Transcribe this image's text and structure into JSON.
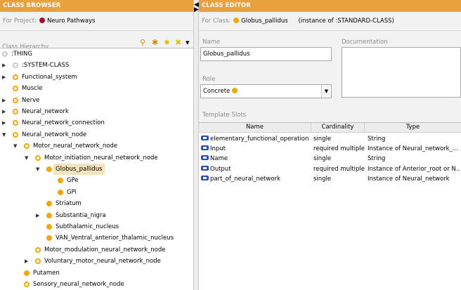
{
  "left_panel": {
    "title": "CLASS BROWSER",
    "for_project_label": "For Project:",
    "project_name": "Neuro Pathways",
    "hierarchy_label": "Class Hierarchy",
    "tools": [
      "search-icon",
      "add-subclass-icon",
      "add-class-icon",
      "delete-icon",
      "dropdown-icon"
    ],
    "tool_glyphs": [
      "⚲",
      "✱",
      "✸",
      "✖",
      "▾"
    ],
    "tree": [
      {
        "label": ":THING",
        "indent": 0,
        "toggle": "",
        "dot": "gray"
      },
      {
        "label": ":SYSTEM-CLASS",
        "indent": 0,
        "toggle": "▶",
        "dot": "gray"
      },
      {
        "label": "Functional_system",
        "indent": 0,
        "toggle": "▶",
        "dot": "hollow"
      },
      {
        "label": "Muscle",
        "indent": 0,
        "toggle": "",
        "dot": "hollow"
      },
      {
        "label": "Nerve",
        "indent": 0,
        "toggle": "▶",
        "dot": "hollow"
      },
      {
        "label": "Neural_network",
        "indent": 0,
        "toggle": "▶",
        "dot": "hollow"
      },
      {
        "label": "Neural_network_connection",
        "indent": 0,
        "toggle": "▶",
        "dot": "hollow"
      },
      {
        "label": "Neural_network_node",
        "indent": 0,
        "toggle": "▼",
        "dot": "hollow"
      },
      {
        "label": "Motor_neural_network_node",
        "indent": 1,
        "toggle": "▼",
        "dot": "hollow"
      },
      {
        "label": "Motor_initiation_neural_network_node",
        "indent": 2,
        "toggle": "▼",
        "dot": "hollow"
      },
      {
        "label": "Globus_pallidus",
        "indent": 3,
        "toggle": "▼",
        "dot": "solid",
        "selected": true
      },
      {
        "label": "GPe",
        "indent": 4,
        "toggle": "",
        "dot": "solid"
      },
      {
        "label": "GPi",
        "indent": 4,
        "toggle": "",
        "dot": "solid"
      },
      {
        "label": "Striatum",
        "indent": 3,
        "toggle": "",
        "dot": "solid"
      },
      {
        "label": "Substantia_nigra",
        "indent": 3,
        "toggle": "▶",
        "dot": "solid"
      },
      {
        "label": "Subthalamic_nucleus",
        "indent": 3,
        "toggle": "",
        "dot": "solid"
      },
      {
        "label": "VAN_Ventral_anterior_thalamic_nucleus",
        "indent": 3,
        "toggle": "",
        "dot": "solid"
      },
      {
        "label": "Motor_modulation_neural_network_node",
        "indent": 2,
        "toggle": "",
        "dot": "hollow"
      },
      {
        "label": "Voluntary_motor_neural_network_node",
        "indent": 2,
        "toggle": "▶",
        "dot": "hollow"
      },
      {
        "label": "Putamen",
        "indent": 1,
        "toggle": "",
        "dot": "solid"
      },
      {
        "label": "Sensory_neural_network_node",
        "indent": 1,
        "toggle": "",
        "dot": "hollow"
      }
    ]
  },
  "right_panel": {
    "title": "CLASS EDITOR",
    "for_class_label": "For Class:",
    "class_name": "Globus_pallidus",
    "instance_of": "(instance of :STANDARD-CLASS)",
    "name_label": "Name",
    "name_value": "Globus_pallidus",
    "documentation_label": "Documentation",
    "role_label": "Role",
    "role_value": "Concrete",
    "template_slots_label": "Template Slots",
    "columns": [
      "Name",
      "Cardinality",
      "Type"
    ],
    "slots": [
      {
        "name": "elementary_functional_operation",
        "cardinality": "single",
        "type": "String"
      },
      {
        "name": "Input",
        "cardinality": "required multiple",
        "type": "Instance of Neural_network_..."
      },
      {
        "name": "Name",
        "cardinality": "single",
        "type": "String"
      },
      {
        "name": "Output",
        "cardinality": "required multiple",
        "type": "Instance of Anterior_root or N..."
      },
      {
        "name": "part_of_neural_network",
        "cardinality": "single",
        "type": "Instance of Neural_network"
      }
    ]
  },
  "colors": {
    "titlebar": "#e8a13c",
    "class_dot": "#f2a800",
    "project_dot": "#a0102a",
    "selection": "#f5e3bd",
    "slot_icon": "#2f4fb5"
  }
}
